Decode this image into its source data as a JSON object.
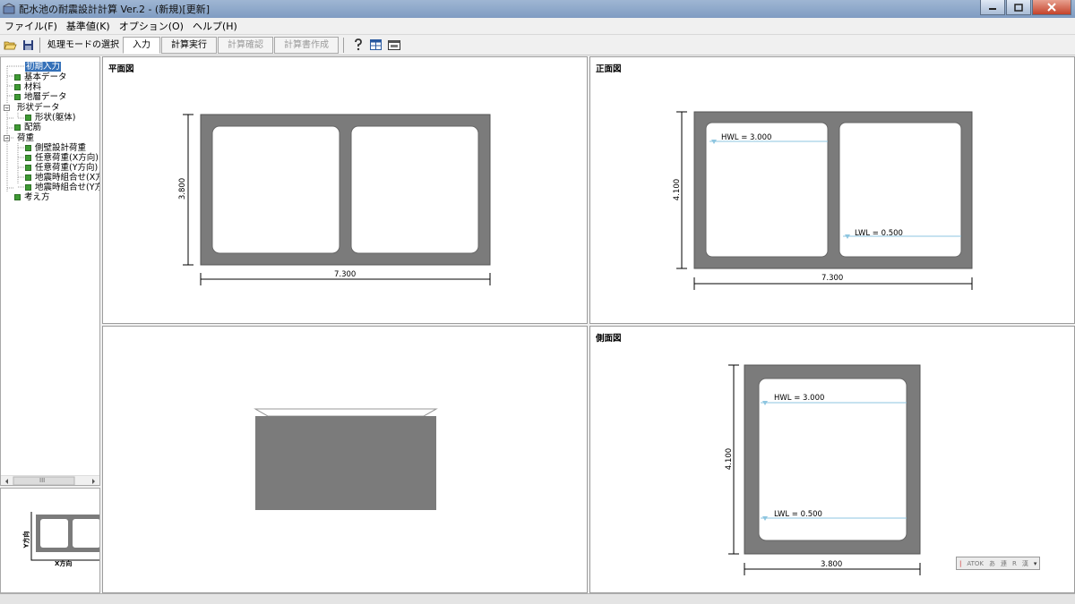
{
  "window": {
    "title": "配水池の耐震設計計算 Ver.2 - (新規)[更新]"
  },
  "menu": [
    "ファイル(F)",
    "基準値(K)",
    "オプション(O)",
    "ヘルプ(H)"
  ],
  "toolbar": {
    "mode_label": "処理モードの選択",
    "modes": [
      {
        "label": "入力",
        "state": "active"
      },
      {
        "label": "計算実行",
        "state": "enabled"
      },
      {
        "label": "計算確認",
        "state": "disabled"
      },
      {
        "label": "計算書作成",
        "state": "disabled"
      }
    ]
  },
  "tree": {
    "items": [
      {
        "label": "初期入力",
        "selected": true
      },
      {
        "label": "基本データ"
      },
      {
        "label": "材料"
      },
      {
        "label": "地層データ"
      },
      {
        "label": "形状データ"
      },
      {
        "label": "形状(躯体)"
      },
      {
        "label": "配筋"
      },
      {
        "label": "荷重"
      },
      {
        "label": "側壁設計荷重"
      },
      {
        "label": "任意荷重(X方向)"
      },
      {
        "label": "任意荷重(Y方向)"
      },
      {
        "label": "地震時組合せ(X方"
      },
      {
        "label": "地震時組合せ(Y方"
      },
      {
        "label": "考え方"
      }
    ],
    "scroll_label": "III"
  },
  "mini": {
    "x_axis": "X方向",
    "y_axis": "Y方向"
  },
  "panes": {
    "plan": {
      "title": "平面図",
      "width_dim": "7.300",
      "height_dim": "3.800"
    },
    "front": {
      "title": "正面図",
      "width_dim": "7.300",
      "height_dim": "4.100",
      "hwl": "HWL = 3.000",
      "lwl": "LWL = 0.500"
    },
    "iso": {
      "title": ""
    },
    "side": {
      "title": "側面図",
      "width_dim": "3.800",
      "height_dim": "4.100",
      "hwl": "HWL = 3.000",
      "lwl": "LWL = 0.500"
    }
  },
  "ime": {
    "items": [
      "ATOK",
      "あ",
      "連",
      "R",
      "漢"
    ]
  },
  "colors": {
    "concrete": "#7b7b7b",
    "water_line": "#8ec6e0",
    "tree_leaf": "#3e9a34",
    "selected": "#3470b8"
  }
}
